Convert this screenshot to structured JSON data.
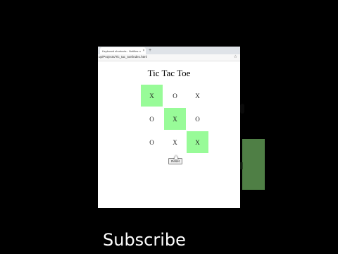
{
  "browser": {
    "tab_title": "Keyboard shortcuts - Notifies n",
    "tab_close": "×",
    "new_tab": "+",
    "url": "op/Projects/Tic_tac_toe/index.html",
    "star_icon": "☆"
  },
  "page": {
    "title": "Tic Tac Toe",
    "board": [
      [
        "X",
        "O",
        "X"
      ],
      [
        "O",
        "X",
        "O"
      ],
      [
        "O",
        "X",
        "X"
      ]
    ],
    "winning_cells": [
      "0-0",
      "1-1",
      "2-2"
    ],
    "reset_label": "Reset"
  },
  "overlay": {
    "subscribe": "Subscribe"
  },
  "colors": {
    "win_highlight": "#98fb98",
    "background_frame": "#000000"
  }
}
